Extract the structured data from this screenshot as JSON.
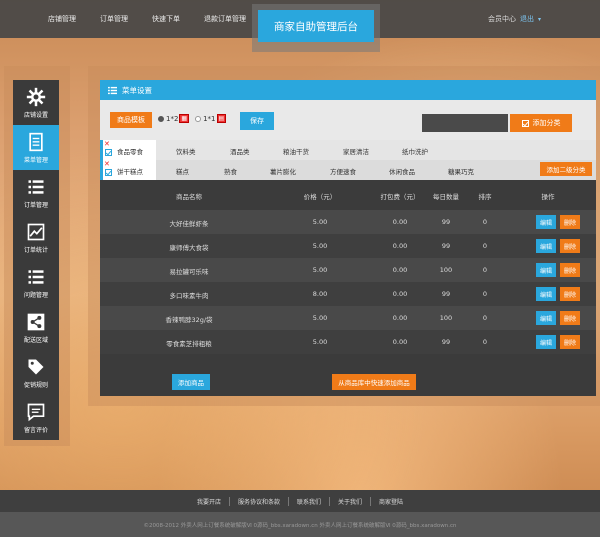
{
  "topnav": [
    "店铺管理",
    "订单管理",
    "快速下单",
    "退款订单管理"
  ],
  "brand": "商家自助管理后台",
  "member": {
    "label": "会员中心",
    "exit": "退出",
    "caret": "▾"
  },
  "sidebar": [
    {
      "label": "店铺设置",
      "icon": "gear-icon"
    },
    {
      "label": "菜单管理",
      "icon": "document-icon",
      "active": true
    },
    {
      "label": "订单管理",
      "icon": "list-icon"
    },
    {
      "label": "订单统计",
      "icon": "chart-icon"
    },
    {
      "label": "问题管理",
      "icon": "list-icon"
    },
    {
      "label": "配送区域",
      "icon": "share-icon"
    },
    {
      "label": "促销规则",
      "icon": "tag-icon"
    },
    {
      "label": "留言评价",
      "icon": "comment-icon"
    }
  ],
  "panel": {
    "title": "菜单设置",
    "template_btn": "商品模板",
    "radio1": "1*2",
    "radio2": "1*1",
    "save": "保存",
    "add_category": "添加分类",
    "add_subcategory": "添加二级分类",
    "add_goods": "添加商品",
    "add_from_lib": "从商品库中快速添加商品"
  },
  "categories": [
    "食品零食",
    "饮料类",
    "酒品类",
    "粮油干货",
    "家居清洁",
    "纸巾洗护"
  ],
  "subcategories": [
    "饼干糕点",
    "糕点",
    "熟食",
    "薯片膨化",
    "方便速食",
    "休闲食品",
    "糖果巧克"
  ],
  "table": {
    "headers": {
      "name": "商品名称",
      "price": "价格（元）",
      "pack": "打包费（元）",
      "qty": "每日数量",
      "sort": "排序",
      "op": "操作"
    },
    "edit": "编辑",
    "delete": "删除",
    "rows": [
      {
        "name": "大好佳鲜虾条",
        "price": "5.00",
        "pack": "0.00",
        "qty": "99",
        "sort": "0"
      },
      {
        "name": "康师傅大食袋",
        "price": "5.00",
        "pack": "0.00",
        "qty": "99",
        "sort": "0"
      },
      {
        "name": "易拉罐可乐味",
        "price": "5.00",
        "pack": "0.00",
        "qty": "100",
        "sort": "0"
      },
      {
        "name": "多口味素牛肉",
        "price": "8.00",
        "pack": "0.00",
        "qty": "99",
        "sort": "0"
      },
      {
        "name": "香辣鸭脖32g/袋",
        "price": "5.00",
        "pack": "0.00",
        "qty": "100",
        "sort": "0"
      },
      {
        "name": "零食素芝排粗粮",
        "price": "5.00",
        "pack": "0.00",
        "qty": "99",
        "sort": "0"
      }
    ]
  },
  "footer_links": [
    "我要开店",
    "服务协议和条款",
    "联系我们",
    "关于我们",
    "商家登陆"
  ],
  "copyright": "©2008-2012 外卖人网上订餐系统破解版Ⅵ 0源码_bbs.xaradown.cn 外卖人网上订餐系统破解版Ⅵ 0源码_bbs.xaradown.cn",
  "colors": {
    "accent": "#2aa7dd",
    "orange": "#f07b18",
    "dark": "#3b3b3b"
  }
}
